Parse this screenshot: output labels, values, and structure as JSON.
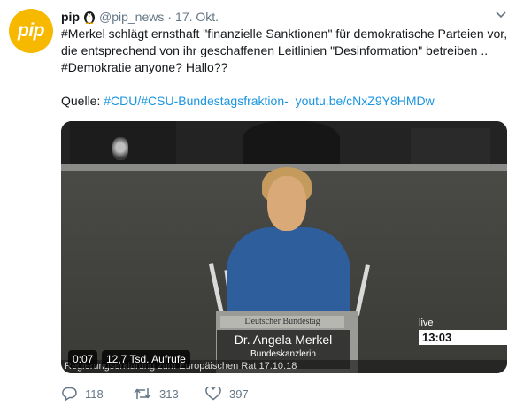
{
  "tweet": {
    "avatar_text": "pip",
    "author_name": "pip",
    "handle": "@pip_news",
    "separator": "·",
    "date": "17. Okt.",
    "text_lines": [
      "#Merkel schlägt ernsthaft \"finanzielle Sanktionen\" für demokratische Parteien vor,",
      "die entsprechend von ihr geschaffenen Leitlinien \"Desinformation\" betreiben ..",
      "#Demokratie anyone? Hallo??"
    ],
    "source_label": "Quelle: ",
    "source_tags": "#CDU/#CSU-Bundestagsfraktion-",
    "source_link": "youtu.be/cNxZ9Y8HMDw"
  },
  "video": {
    "plate": "Deutscher Bundestag",
    "speaker_name": "Dr. Angela Merkel",
    "speaker_role": "Bundeskanzlerin",
    "live_label": "live",
    "clock": "13:03",
    "caption": "Regierungserklärung zum Europäischen Rat 17.10.18",
    "duration": "0:07",
    "views": "12,7 Tsd. Aufrufe"
  },
  "actions": {
    "replies": "118",
    "retweets": "313",
    "likes": "397"
  },
  "colors": {
    "link": "#1b95e0",
    "muted": "#657786",
    "avatar": "#f6b900"
  },
  "icons": [
    "penguin-icon",
    "chevron-down-icon",
    "reply-icon",
    "retweet-icon",
    "like-icon"
  ]
}
